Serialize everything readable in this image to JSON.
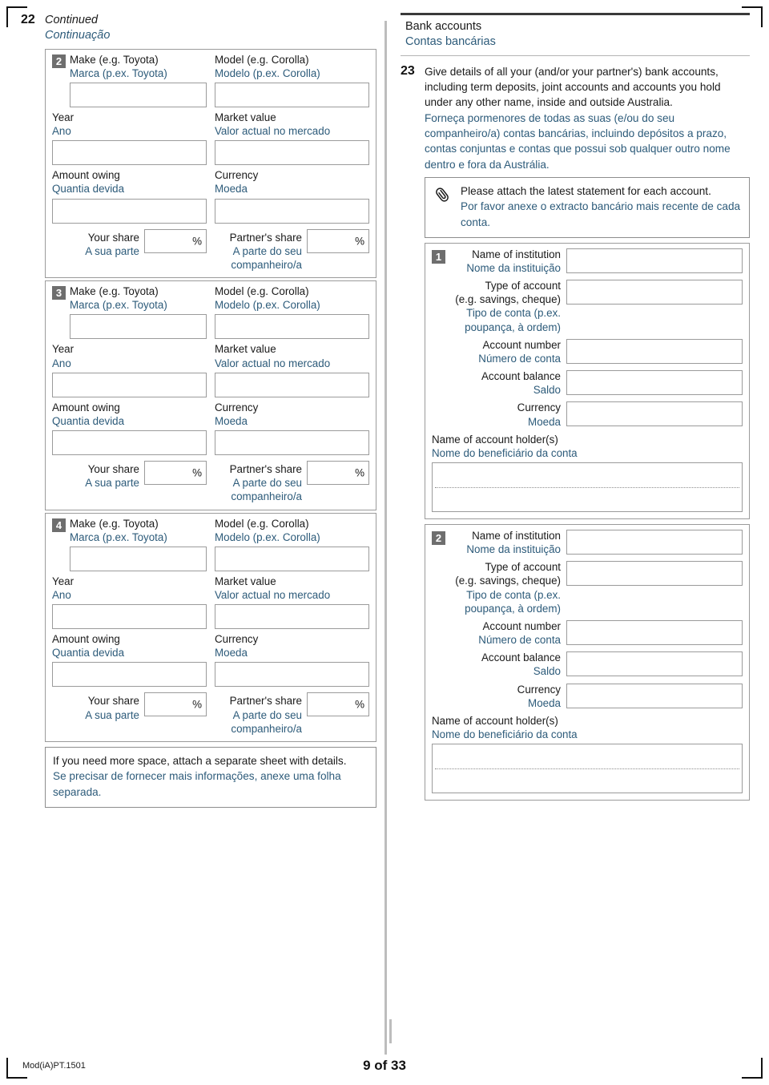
{
  "page": {
    "footer_code": "Mod(iA)PT.1501",
    "page_number": "9 of 33"
  },
  "left_column": {
    "question_number": "22",
    "heading_en": "Continued",
    "heading_pt": "Continuação",
    "vehicle_labels": {
      "make_en": "Make (e.g. Toyota)",
      "make_pt": "Marca (p.ex.  Toyota)",
      "model_en": "Model (e.g. Corolla)",
      "model_pt": "Modelo (p.ex. Corolla)",
      "year_en": "Year",
      "year_pt": "Ano",
      "market_value_en": "Market value",
      "market_value_pt": "Valor actual no mercado",
      "amount_owing_en": "Amount owing",
      "amount_owing_pt": "Quantia devida",
      "currency_en": "Currency",
      "currency_pt": "Moeda",
      "your_share_en": "Your share",
      "your_share_pt": "A sua parte",
      "partner_share_en": "Partner's share",
      "partner_share_pt_1": "A parte do seu",
      "partner_share_pt_2": "companheiro/a",
      "percent_symbol": "%"
    },
    "vehicles": [
      {
        "badge": "2"
      },
      {
        "badge": "3"
      },
      {
        "badge": "4"
      }
    ],
    "more_space_note_en": "If you need more space, attach a separate sheet with details.",
    "more_space_note_pt": "Se precisar de fornecer mais informações, anexe uma folha separada."
  },
  "right_column": {
    "section_title_en": "Bank accounts",
    "section_title_pt": "Contas bancárias",
    "question_number": "23",
    "question_en": "Give details of all your (and/or your partner's) bank accounts, including term deposits, joint accounts and accounts you hold under any other name, inside and outside Australia.",
    "question_pt": "Forneça pormenores de todas as suas (e/ou do seu companheiro/a) contas bancárias, incluindo depósitos a prazo, contas conjuntas e contas que possui sob qualquer outro nome dentro e fora da Austrália.",
    "attach_note_en": "Please attach the latest statement for each account.",
    "attach_note_pt": "Por favor anexe o extracto bancário mais recente de cada conta.",
    "attach_icon": "paperclip-icon",
    "account_labels": {
      "institution_en": "Name of institution",
      "institution_pt": "Nome da instituição",
      "type_en_1": "Type of account",
      "type_en_2": "(e.g. savings, cheque)",
      "type_pt_1": "Tipo de conta (p.ex.",
      "type_pt_2": "poupança, à ordem)",
      "account_number_en": "Account number",
      "account_number_pt": "Número de conta",
      "balance_en": "Account balance",
      "balance_pt": "Saldo",
      "currency_en": "Currency",
      "currency_pt": "Moeda",
      "holder_en": "Name of account holder(s)",
      "holder_pt": "Nome do beneficiário da conta"
    },
    "accounts": [
      {
        "badge": "1"
      },
      {
        "badge": "2"
      }
    ]
  },
  "colors": {
    "portuguese_text": "#2d5b7a",
    "english_text": "#1a1a1a",
    "badge_background": "#6e6e6e",
    "field_border": "#9b9b9b",
    "rule_dark": "#3a3a3a"
  }
}
